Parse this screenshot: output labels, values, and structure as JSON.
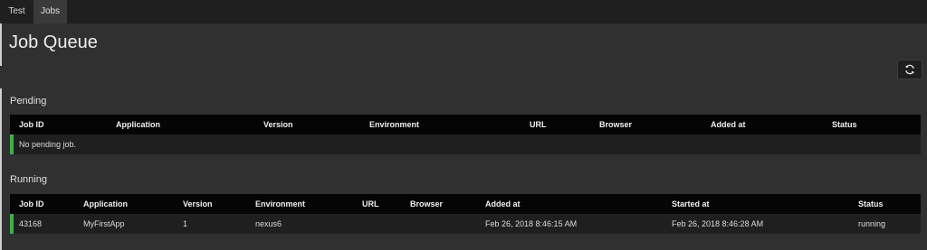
{
  "tabs": [
    "Test",
    "Jobs"
  ],
  "page": {
    "title": "Job Queue"
  },
  "refresh": {
    "icon": "refresh-icon"
  },
  "pending": {
    "title": "Pending",
    "columns": [
      "Job ID",
      "Application",
      "Version",
      "Environment",
      "URL",
      "Browser",
      "Added at",
      "Status"
    ],
    "empty_message": "No pending job."
  },
  "running": {
    "title": "Running",
    "columns": [
      "Job ID",
      "Application",
      "Version",
      "Environment",
      "URL",
      "Browser",
      "Added at",
      "Started at",
      "Status"
    ],
    "rows": [
      {
        "job_id": "43168",
        "application": "MyFirstApp",
        "version": "1",
        "environment": "nexus6",
        "url": "",
        "browser": "",
        "added_at": "Feb 26, 2018 8:46:15 AM",
        "started_at": "Feb 26, 2018 8:46:28 AM",
        "status": "running"
      }
    ]
  },
  "colors": {
    "accent": "#3fae49",
    "background": "#303030",
    "header": "#050505"
  }
}
